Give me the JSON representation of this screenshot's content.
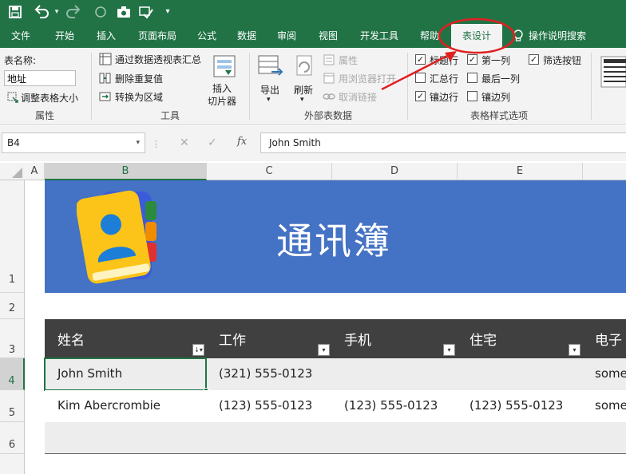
{
  "quick_access": {
    "save_icon": "save-icon",
    "undo_icon": "undo-icon",
    "redo_icon": "redo-icon",
    "circle_icon": "circle-icon",
    "camera_icon": "camera-icon",
    "check_icon": "check-icon",
    "more_icon": "more-icon"
  },
  "tabs": [
    {
      "label": "文件"
    },
    {
      "label": "开始"
    },
    {
      "label": "插入"
    },
    {
      "label": "页面布局"
    },
    {
      "label": "公式"
    },
    {
      "label": "数据"
    },
    {
      "label": "审阅"
    },
    {
      "label": "视图"
    },
    {
      "label": "开发工具"
    },
    {
      "label": "帮助"
    },
    {
      "label": "表设计",
      "active": true
    }
  ],
  "tell_me": "操作说明搜索",
  "ribbon": {
    "properties": {
      "table_name_label": "表名称:",
      "table_name_value": "地址",
      "resize_table": "调整表格大小",
      "group_label": "属性"
    },
    "tools": {
      "summarize_pivot": "通过数据透视表汇总",
      "remove_duplicates": "删除重复值",
      "convert_to_range": "转换为区域",
      "insert_slicer_line1": "插入",
      "insert_slicer_line2": "切片器",
      "group_label": "工具"
    },
    "external": {
      "export": "导出",
      "refresh": "刷新",
      "properties": "属性",
      "open_in_browser": "用浏览器打开",
      "unlink": "取消链接",
      "group_label": "外部表数据"
    },
    "style_options": {
      "header_row": {
        "label": "标题行",
        "checked": true
      },
      "total_row": {
        "label": "汇总行",
        "checked": false
      },
      "banded_rows": {
        "label": "镶边行",
        "checked": true
      },
      "first_column": {
        "label": "第一列",
        "checked": true
      },
      "last_column": {
        "label": "最后一列",
        "checked": false
      },
      "banded_columns": {
        "label": "镶边列",
        "checked": false
      },
      "filter_button": {
        "label": "筛选按钮",
        "checked": true
      },
      "group_label": "表格样式选项"
    }
  },
  "formula_bar": {
    "name_box": "B4",
    "formula": "John Smith",
    "cancel": "✕",
    "enter": "✓",
    "fx": "fx"
  },
  "columns": [
    "A",
    "B",
    "C",
    "D",
    "E"
  ],
  "rows": [
    "1",
    "2",
    "3",
    "4",
    "5",
    "6"
  ],
  "sheet": {
    "banner_title": "通讯簿",
    "headers": [
      "姓名",
      "工作",
      "手机",
      "住宅",
      "电子"
    ],
    "data": [
      [
        "John Smith",
        "(321) 555-0123",
        "",
        "",
        "some"
      ],
      [
        "Kim Abercrombie",
        "(123) 555-0123",
        "(123) 555-0123",
        "(123) 555-0123",
        "some"
      ]
    ]
  },
  "colors": {
    "excel_green": "#217346",
    "banner_blue": "#4472c4",
    "header_dark": "#404040",
    "annotation_red": "#e02020"
  }
}
